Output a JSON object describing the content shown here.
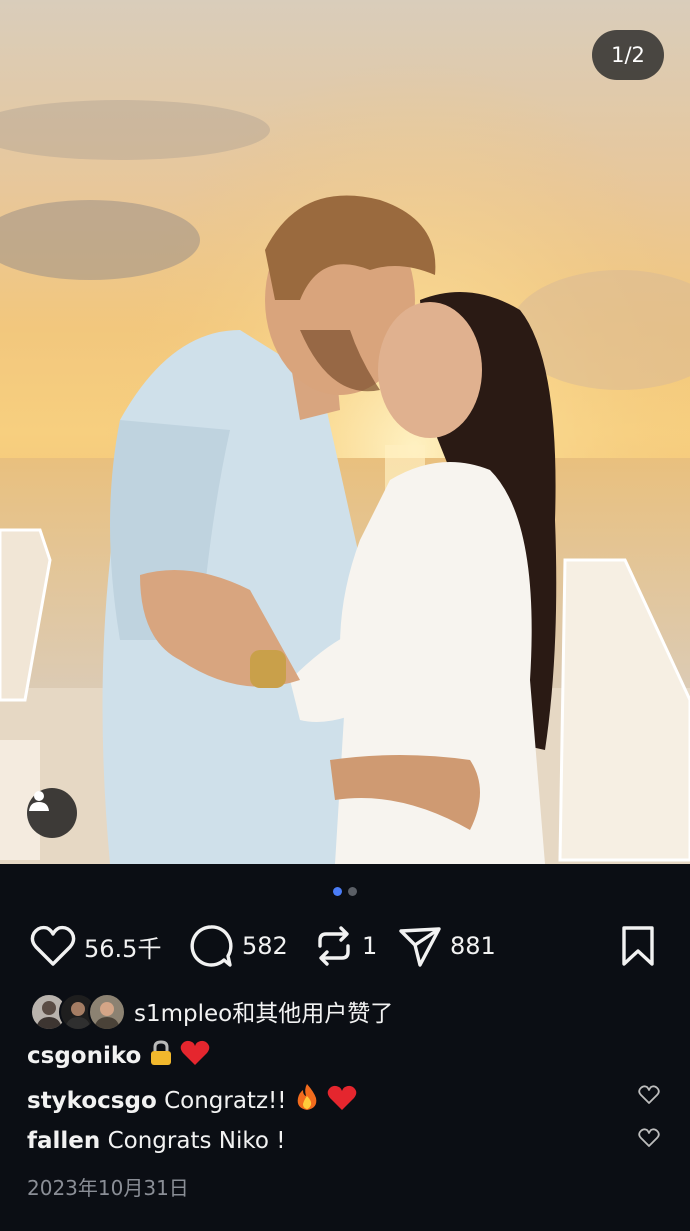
{
  "post": {
    "image_counter": "1/2",
    "page_indicator": {
      "total": 2,
      "active": 1
    }
  },
  "actions": {
    "likes": "56.5千",
    "comments": "582",
    "reposts": "1",
    "shares": "881"
  },
  "liked_by": {
    "text": "s1mpleo和其他用户赞了"
  },
  "caption": {
    "user": "csgoniko",
    "emojis": [
      "lock",
      "red-heart"
    ]
  },
  "comments": [
    {
      "user": "stykocsgo",
      "text": "Congratz!!",
      "emojis": [
        "fire",
        "red-heart"
      ]
    },
    {
      "user": "fallen",
      "text": "Congrats Niko !"
    }
  ],
  "date": "2023年10月31日",
  "colors": {
    "background": "#0b0e14",
    "accent_dot": "#4a7cf7",
    "muted": "#8a8e96"
  }
}
